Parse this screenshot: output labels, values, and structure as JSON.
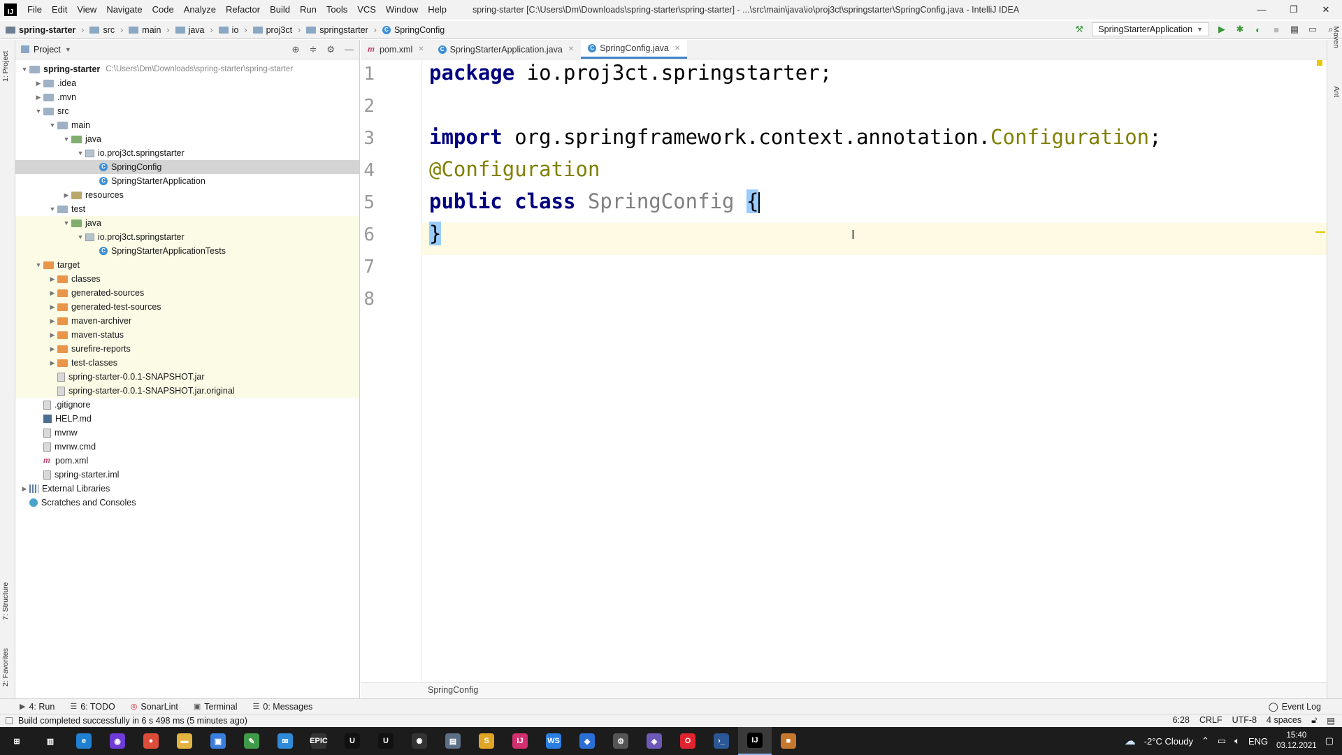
{
  "menubar": {
    "items": [
      "File",
      "Edit",
      "View",
      "Navigate",
      "Code",
      "Analyze",
      "Refactor",
      "Build",
      "Run",
      "Tools",
      "VCS",
      "Window",
      "Help"
    ],
    "window_title": "spring-starter [C:\\Users\\Dm\\Downloads\\spring-starter\\spring-starter] - ...\\src\\main\\java\\io\\proj3ct\\springstarter\\SpringConfig.java - IntelliJ IDEA",
    "win_controls": [
      "—",
      "❐",
      "✕"
    ]
  },
  "navbar": {
    "crumbs": [
      "spring-starter",
      "src",
      "main",
      "java",
      "io",
      "proj3ct",
      "springstarter",
      "SpringConfig"
    ],
    "run_config": "SpringStarterApplication"
  },
  "side_tabs": {
    "left_top": "1: Project",
    "left_structure": "7: Structure",
    "left_favorites": "2: Favorites",
    "right_maven": "Maven",
    "right_ant": "Ant"
  },
  "project": {
    "header_title": "Project",
    "tree": [
      {
        "label": "spring-starter",
        "hint": "C:\\Users\\Dm\\Downloads\\spring-starter\\spring-starter",
        "level": 0,
        "arrow": "▼",
        "icon": "folder",
        "bold": true
      },
      {
        "label": ".idea",
        "level": 1,
        "arrow": "▶",
        "icon": "folder"
      },
      {
        "label": ".mvn",
        "level": 1,
        "arrow": "▶",
        "icon": "folder"
      },
      {
        "label": "src",
        "level": 1,
        "arrow": "▼",
        "icon": "folder"
      },
      {
        "label": "main",
        "level": 2,
        "arrow": "▼",
        "icon": "folder"
      },
      {
        "label": "java",
        "level": 3,
        "arrow": "▼",
        "icon": "folder-src"
      },
      {
        "label": "io.proj3ct.springstarter",
        "level": 4,
        "arrow": "▼",
        "icon": "pkg"
      },
      {
        "label": "SpringConfig",
        "level": 5,
        "arrow": "",
        "icon": "cls",
        "selected": true
      },
      {
        "label": "SpringStarterApplication",
        "level": 5,
        "arrow": "",
        "icon": "cls"
      },
      {
        "label": "resources",
        "level": 3,
        "arrow": "▶",
        "icon": "folder-res"
      },
      {
        "label": "test",
        "level": 2,
        "arrow": "▼",
        "icon": "folder"
      },
      {
        "label": "java",
        "level": 3,
        "arrow": "▼",
        "icon": "folder-src",
        "excluded": true
      },
      {
        "label": "io.proj3ct.springstarter",
        "level": 4,
        "arrow": "▼",
        "icon": "pkg",
        "excluded": true
      },
      {
        "label": "SpringStarterApplicationTests",
        "level": 5,
        "arrow": "",
        "icon": "cls",
        "excluded": true
      },
      {
        "label": "target",
        "level": 1,
        "arrow": "▼",
        "icon": "folder-orange",
        "excluded": true
      },
      {
        "label": "classes",
        "level": 2,
        "arrow": "▶",
        "icon": "folder-orange",
        "excluded": true
      },
      {
        "label": "generated-sources",
        "level": 2,
        "arrow": "▶",
        "icon": "folder-orange",
        "excluded": true
      },
      {
        "label": "generated-test-sources",
        "level": 2,
        "arrow": "▶",
        "icon": "folder-orange",
        "excluded": true
      },
      {
        "label": "maven-archiver",
        "level": 2,
        "arrow": "▶",
        "icon": "folder-orange",
        "excluded": true
      },
      {
        "label": "maven-status",
        "level": 2,
        "arrow": "▶",
        "icon": "folder-orange",
        "excluded": true
      },
      {
        "label": "surefire-reports",
        "level": 2,
        "arrow": "▶",
        "icon": "folder-orange",
        "excluded": true
      },
      {
        "label": "test-classes",
        "level": 2,
        "arrow": "▶",
        "icon": "folder-orange",
        "excluded": true
      },
      {
        "label": "spring-starter-0.0.1-SNAPSHOT.jar",
        "level": 2,
        "arrow": "",
        "icon": "file",
        "excluded": true
      },
      {
        "label": "spring-starter-0.0.1-SNAPSHOT.jar.original",
        "level": 2,
        "arrow": "",
        "icon": "file",
        "excluded": true
      },
      {
        "label": ".gitignore",
        "level": 1,
        "arrow": "",
        "icon": "file"
      },
      {
        "label": "HELP.md",
        "level": 1,
        "arrow": "",
        "icon": "md"
      },
      {
        "label": "mvnw",
        "level": 1,
        "arrow": "",
        "icon": "file"
      },
      {
        "label": "mvnw.cmd",
        "level": 1,
        "arrow": "",
        "icon": "file"
      },
      {
        "label": "pom.xml",
        "level": 1,
        "arrow": "",
        "icon": "maven"
      },
      {
        "label": "spring-starter.iml",
        "level": 1,
        "arrow": "",
        "icon": "file"
      },
      {
        "label": "External Libraries",
        "level": 0,
        "arrow": "▶",
        "icon": "lib"
      },
      {
        "label": "Scratches and Consoles",
        "level": 0,
        "arrow": "",
        "icon": "scratch"
      }
    ]
  },
  "editor": {
    "tabs": [
      {
        "label": "pom.xml",
        "icon": "xml",
        "active": false
      },
      {
        "label": "SpringStarterApplication.java",
        "icon": "cls",
        "active": false
      },
      {
        "label": "SpringConfig.java",
        "icon": "cls",
        "active": true
      }
    ],
    "line_numbers": [
      "1",
      "2",
      "3",
      "4",
      "5",
      "6",
      "7",
      "8"
    ],
    "code": {
      "l1_kw": "package",
      "l1_rest": " io.proj3ct.springstarter;",
      "l3_kw": "import",
      "l3_rest": " org.springframework.context.annotation.",
      "l3_cls": "Configuration",
      "l3_end": ";",
      "l5_ann": "@Configuration",
      "l6_kw": "public class",
      "l6_name": " SpringConfig ",
      "l6_brace": "{",
      "l7_brace": "}"
    },
    "breadcrumb": "SpringConfig"
  },
  "tool_tabs": {
    "run": "4: Run",
    "todo": "6: TODO",
    "sonarlint": "SonarLint",
    "terminal": "Terminal",
    "messages": "0: Messages",
    "event_log": "Event Log"
  },
  "statusbar": {
    "message": "Build completed successfully in 6 s 498 ms (5 minutes ago)",
    "position": "6:28",
    "line_sep": "CRLF",
    "encoding": "UTF-8",
    "indent": "4 spaces"
  },
  "taskbar": {
    "weather": "-2°C  Cloudy",
    "lang": "ENG",
    "time": "15:40",
    "date": "03.12.2021",
    "apps": [
      {
        "name": "start-icon",
        "color": "#1c1c1c",
        "glyph": "⊞"
      },
      {
        "name": "task-view-icon",
        "color": "#1c1c1c",
        "glyph": "▥"
      },
      {
        "name": "edge-icon",
        "color": "#1f7fd1",
        "glyph": "e"
      },
      {
        "name": "app-purple-icon",
        "color": "#6e3bd6",
        "glyph": "◉"
      },
      {
        "name": "chrome-icon",
        "color": "#dd4b39",
        "glyph": "●"
      },
      {
        "name": "explorer-icon",
        "color": "#e3b341",
        "glyph": "▬"
      },
      {
        "name": "store-icon",
        "color": "#3b7ddd",
        "glyph": "▣"
      },
      {
        "name": "notepad-icon",
        "color": "#3f9b4a",
        "glyph": "✎"
      },
      {
        "name": "mail-icon",
        "color": "#2f8ad8",
        "glyph": "✉"
      },
      {
        "name": "epic-games-icon",
        "color": "#333333",
        "glyph": "EPIC"
      },
      {
        "name": "unreal-icon",
        "color": "#111111",
        "glyph": "U"
      },
      {
        "name": "unity-icon",
        "color": "#111111",
        "glyph": "U"
      },
      {
        "name": "blender-icon",
        "color": "#333333",
        "glyph": "✺"
      },
      {
        "name": "files-icon",
        "color": "#5b6f86",
        "glyph": "▤"
      },
      {
        "name": "sublime-icon",
        "color": "#e0a526",
        "glyph": "S"
      },
      {
        "name": "idea-community-icon",
        "color": "#d12f6e",
        "glyph": "IJ"
      },
      {
        "name": "webstorm-icon",
        "color": "#2a7de1",
        "glyph": "WS"
      },
      {
        "name": "app-blue-icon",
        "color": "#2b6fd6",
        "glyph": "◆"
      },
      {
        "name": "settings-icon",
        "color": "#555555",
        "glyph": "⚙"
      },
      {
        "name": "visual-studio-icon",
        "color": "#6d58b8",
        "glyph": "◈"
      },
      {
        "name": "opera-icon",
        "color": "#e0242f",
        "glyph": "O"
      },
      {
        "name": "powershell-icon",
        "color": "#2b5797",
        "glyph": "›_"
      },
      {
        "name": "intellij-icon",
        "color": "#000000",
        "glyph": "IJ"
      },
      {
        "name": "package-icon",
        "color": "#c8782e",
        "glyph": "■"
      }
    ]
  }
}
